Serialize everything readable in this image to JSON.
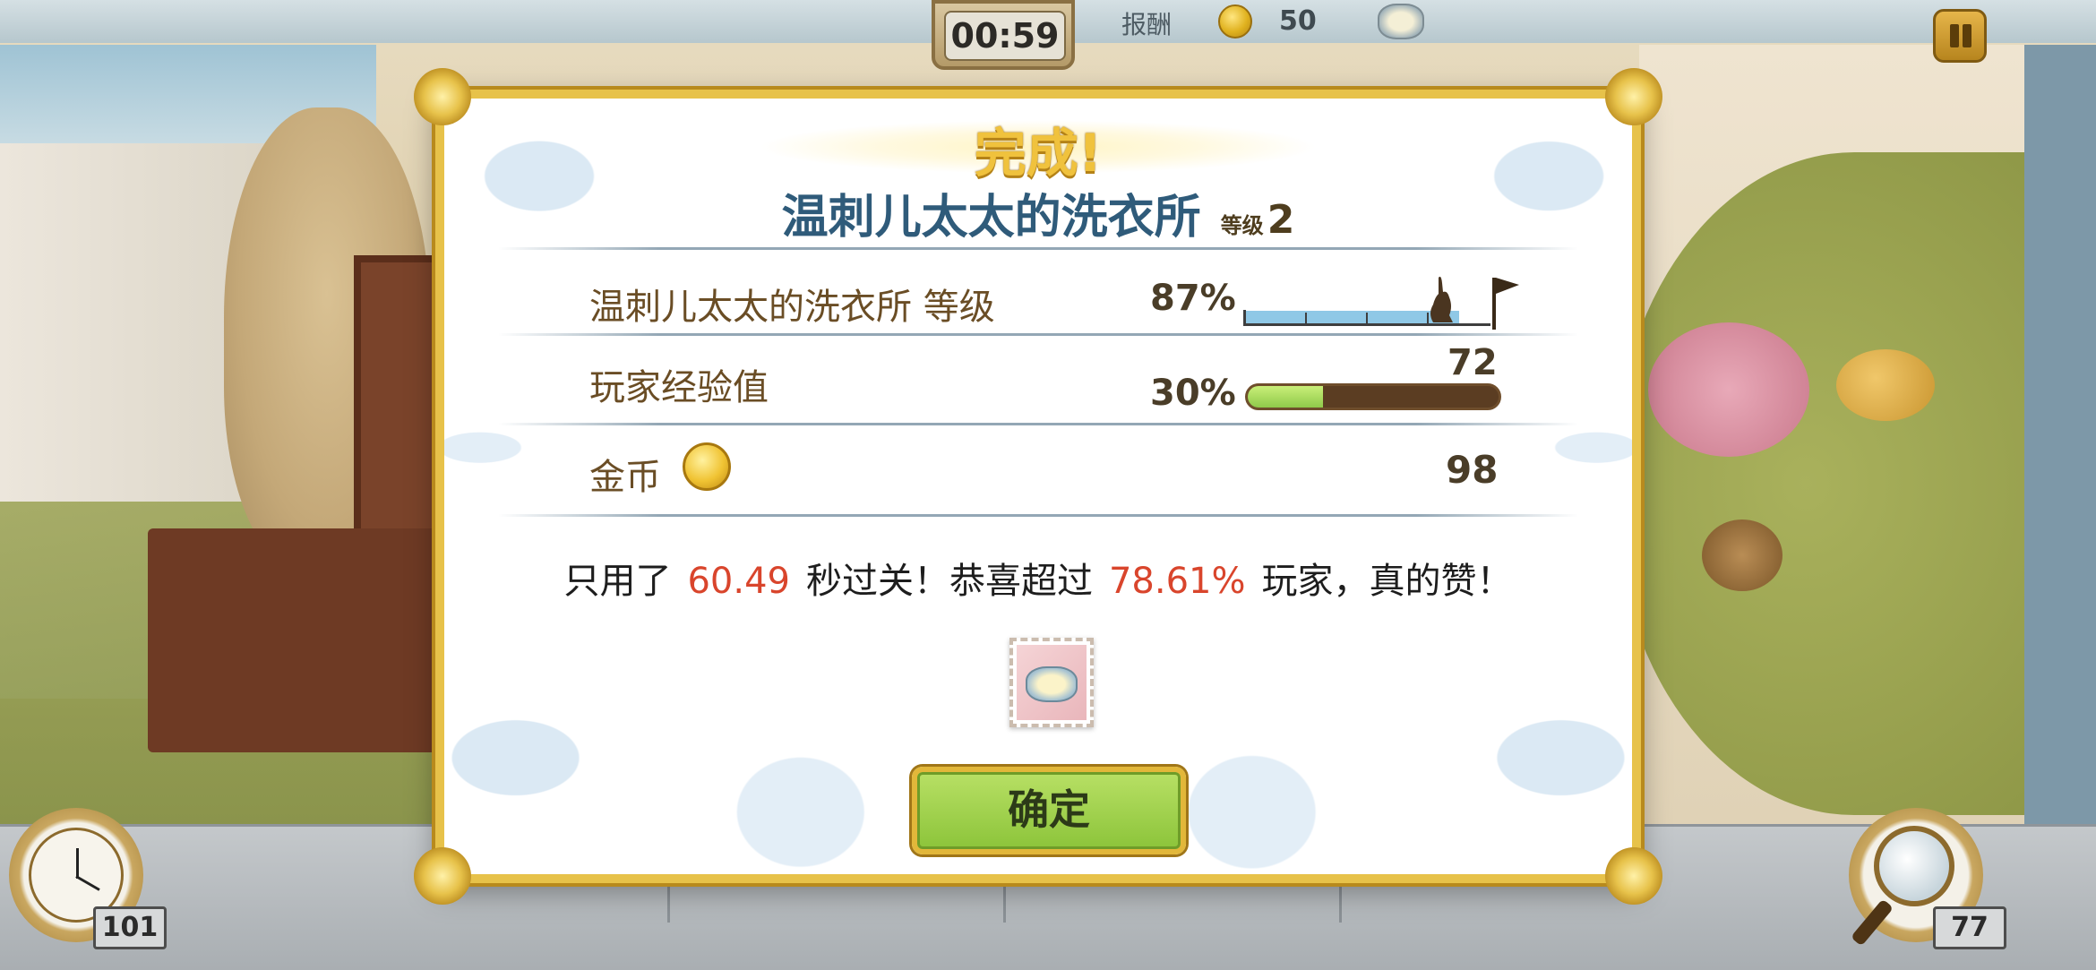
{
  "hud": {
    "timer": "00:59",
    "reward_label": "报酬",
    "reward_value": "50"
  },
  "dialog": {
    "title": "完成!",
    "level_name": "温刺儿太太的洗衣所",
    "level_label": "等级",
    "level_number": "2",
    "rows": {
      "location_level": {
        "label": "温刺儿太太的洗衣所  等级",
        "percent": "87%",
        "progress": 0.87
      },
      "player_xp": {
        "label": "玩家经验值",
        "percent": "30%",
        "progress": 0.3,
        "value": "72"
      },
      "gold": {
        "label": "金币",
        "value": "98"
      }
    },
    "result": {
      "prefix": "只用了",
      "time": "60.49",
      "middle": "秒过关！恭喜超过",
      "percent": "78.61%",
      "suffix": "玩家，真的赞！"
    },
    "ok_button": "确定"
  },
  "tools": {
    "clock_count": "101",
    "magnifier_count": "77"
  },
  "icons": [
    "coin-icon",
    "soap-icon",
    "pause-icon",
    "clock-icon",
    "magnifier-icon",
    "rabbit-icon",
    "flag-icon"
  ],
  "colors": {
    "title_gold": "#f0c23d",
    "level_blue": "#2f5b7a",
    "highlight_red": "#d9452c",
    "xp_green": "#9cd353",
    "level_bar_blue": "#8fc8e6"
  }
}
